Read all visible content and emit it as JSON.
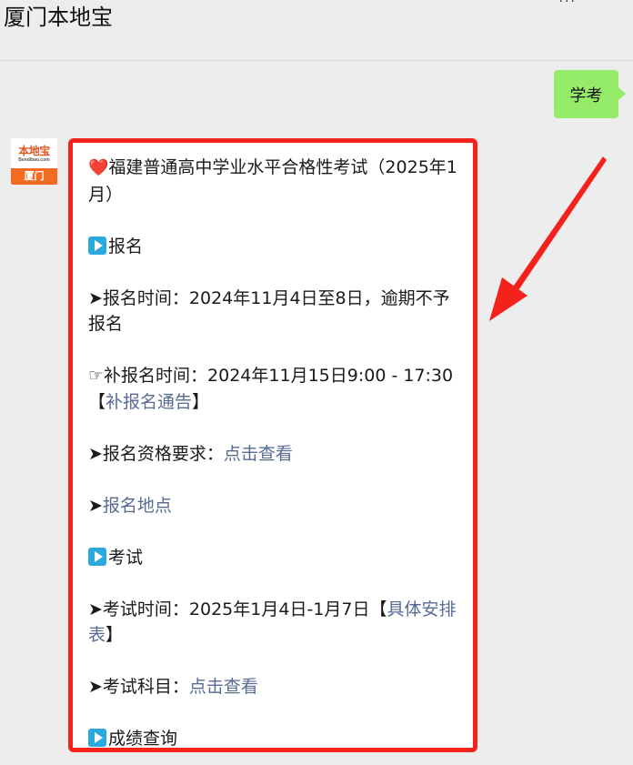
{
  "header": {
    "title": "厦门本地宝",
    "dots": "···"
  },
  "chat": {
    "sent_message": "学考",
    "avatar": {
      "top_text": "本地宝",
      "sub_text": "Bendibao.com",
      "bottom_text": "厦门"
    },
    "received": {
      "title_icon": "❤️",
      "title": "福建普通高中学业水平合格性考试（2025年1月）",
      "section1": {
        "icon": "play-button-icon",
        "label": "报名"
      },
      "reg_time": {
        "prefix": "➤报名时间：",
        "text": "2024年11月4日至8日，逾期不予报名"
      },
      "supp_time": {
        "prefix": "☞补报名时间：",
        "text": "2024年11月15日9:00 - 17:30【",
        "link": "补报名通告",
        "suffix": "】"
      },
      "requirements": {
        "prefix": "➤报名资格要求：",
        "link": "点击查看"
      },
      "location": {
        "prefix": "➤",
        "link": "报名地点"
      },
      "section2": {
        "icon": "play-button-icon",
        "label": "考试"
      },
      "exam_time": {
        "prefix": "➤考试时间：2025年1月4日-1月7日【",
        "link": "具体安排表",
        "suffix": "】"
      },
      "subjects": {
        "prefix": "➤考试科目：",
        "link": "点击查看"
      },
      "section3": {
        "icon": "play-button-icon",
        "label": "成绩查询"
      }
    }
  },
  "colors": {
    "background": "#ededed",
    "sent_bubble": "#95ec69",
    "link": "#576b95",
    "highlight_border": "#f4221b",
    "section_icon": "#2aa8e0"
  }
}
